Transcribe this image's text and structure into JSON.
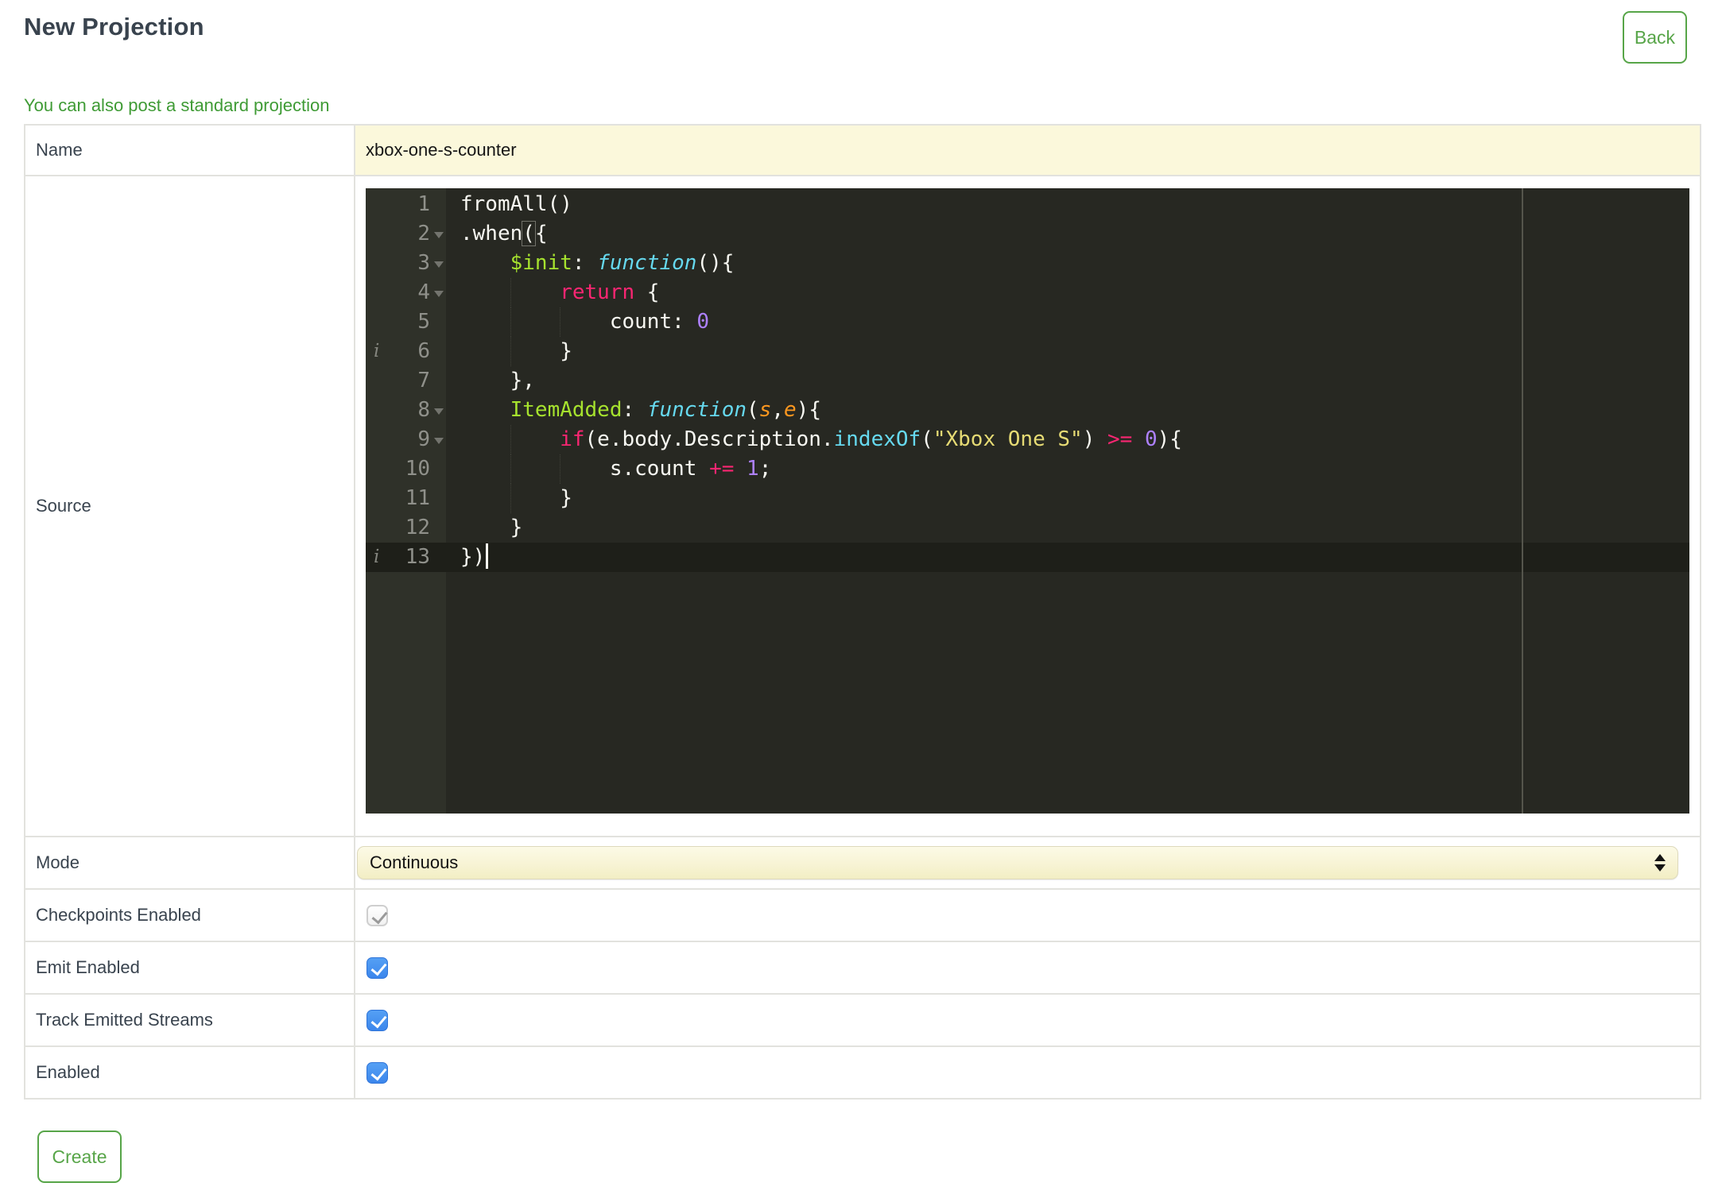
{
  "header": {
    "title": "New Projection",
    "back_label": "Back",
    "link_text": "You can also post a standard projection"
  },
  "form": {
    "name": {
      "label": "Name",
      "value": "xbox-one-s-counter"
    },
    "source": {
      "label": "Source"
    },
    "mode": {
      "label": "Mode",
      "value": "Continuous"
    },
    "checkboxes": [
      {
        "label": "Checkpoints Enabled",
        "checked": true,
        "disabled": true
      },
      {
        "label": "Emit Enabled",
        "checked": true,
        "disabled": false
      },
      {
        "label": "Track Emitted Streams",
        "checked": true,
        "disabled": false
      },
      {
        "label": "Enabled",
        "checked": true,
        "disabled": false
      }
    ],
    "create_label": "Create"
  },
  "editor": {
    "active_line": 13,
    "annotation_lines": [
      6,
      13
    ],
    "fold_lines": [
      2,
      3,
      4,
      8,
      9
    ],
    "lines": [
      {
        "n": 1,
        "indent": 0,
        "tokens": [
          [
            "fromAll()",
            "plain"
          ]
        ]
      },
      {
        "n": 2,
        "indent": 0,
        "tokens": [
          [
            ".when",
            "plain"
          ],
          [
            "(",
            "plain boxed"
          ],
          [
            "{",
            "plain"
          ]
        ]
      },
      {
        "n": 3,
        "indent": 4,
        "tokens": [
          [
            "$init",
            "key"
          ],
          [
            ": ",
            "plain"
          ],
          [
            "function",
            "fn"
          ],
          [
            "(){",
            "plain"
          ]
        ]
      },
      {
        "n": 4,
        "indent": 8,
        "tokens": [
          [
            "return",
            "kw"
          ],
          [
            " {",
            "plain"
          ]
        ]
      },
      {
        "n": 5,
        "indent": 12,
        "tokens": [
          [
            "count: ",
            "plain"
          ],
          [
            "0",
            "num"
          ]
        ]
      },
      {
        "n": 6,
        "indent": 8,
        "tokens": [
          [
            "}",
            "plain"
          ]
        ]
      },
      {
        "n": 7,
        "indent": 4,
        "tokens": [
          [
            "},",
            "plain"
          ]
        ]
      },
      {
        "n": 8,
        "indent": 4,
        "tokens": [
          [
            "ItemAdded",
            "key"
          ],
          [
            ": ",
            "plain"
          ],
          [
            "function",
            "fn"
          ],
          [
            "(",
            "plain"
          ],
          [
            "s",
            "param"
          ],
          [
            ",",
            "plain"
          ],
          [
            "e",
            "param"
          ],
          [
            "){",
            "plain"
          ]
        ]
      },
      {
        "n": 9,
        "indent": 8,
        "tokens": [
          [
            "if",
            "kw"
          ],
          [
            "(e.body.Description.",
            "plain"
          ],
          [
            "indexOf",
            "call"
          ],
          [
            "(",
            "plain"
          ],
          [
            "\"Xbox One S\"",
            "str"
          ],
          [
            ") ",
            "plain"
          ],
          [
            ">=",
            "kw"
          ],
          [
            " ",
            "plain"
          ],
          [
            "0",
            "num"
          ],
          [
            "){",
            "plain"
          ]
        ]
      },
      {
        "n": 10,
        "indent": 12,
        "tokens": [
          [
            "s.count ",
            "plain"
          ],
          [
            "+=",
            "kw"
          ],
          [
            " ",
            "plain"
          ],
          [
            "1",
            "num"
          ],
          [
            ";",
            "plain"
          ]
        ]
      },
      {
        "n": 11,
        "indent": 8,
        "tokens": [
          [
            "}",
            "plain"
          ]
        ]
      },
      {
        "n": 12,
        "indent": 4,
        "tokens": [
          [
            "}",
            "plain"
          ]
        ]
      },
      {
        "n": 13,
        "indent": 0,
        "tokens": [
          [
            "})",
            "plain"
          ]
        ],
        "cursor": true
      }
    ]
  },
  "colors": {
    "accent_green": "#57A548",
    "link_green": "#3F9B35",
    "heading_slate": "#39434E",
    "input_yellow": "#FBF8DB",
    "checkbox_blue": "#4190F0",
    "editor_bg": "#272822",
    "editor_gutter_bg": "#2F3129",
    "code_plain": "#F8F8F2",
    "code_key": "#A6E22E",
    "code_keyword": "#F92672",
    "code_function": "#66D9EF",
    "code_number": "#AE81FF",
    "code_string": "#E6DB74",
    "code_param": "#FD971F"
  }
}
